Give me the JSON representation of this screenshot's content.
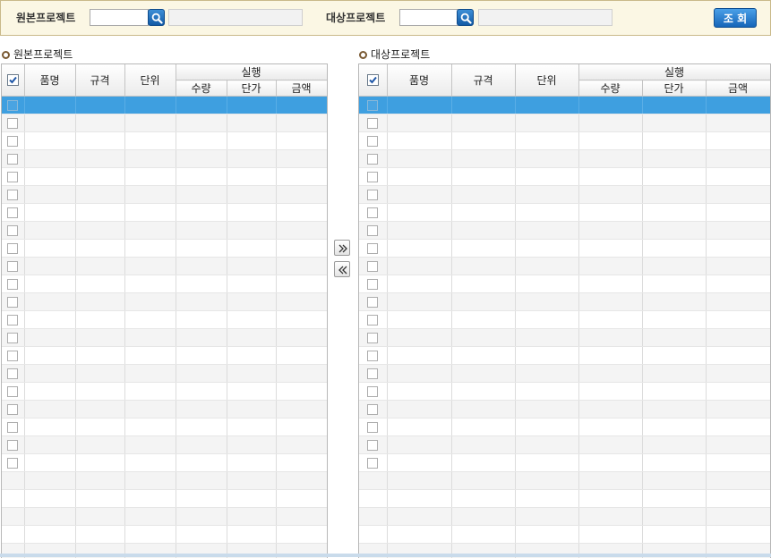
{
  "search": {
    "source_label": "원본프로젝트",
    "source_code": "",
    "source_name": "",
    "target_label": "대상프로젝트",
    "target_code": "",
    "target_name": "",
    "query_label": "조 회"
  },
  "left_panel": {
    "title": "원본프로젝트"
  },
  "right_panel": {
    "title": "대상프로젝트"
  },
  "columns": {
    "item": "품명",
    "spec": "규격",
    "unit": "단위",
    "exec": "실행",
    "qty": "수량",
    "price": "단가",
    "amount": "금액"
  },
  "header_checkbox_checked": true,
  "grid_rows": 26,
  "checkbox_rows": 21,
  "selected_row": 0,
  "colors": {
    "selected_row": "#3e9fe0",
    "search_bg": "#fbf7e4",
    "accent": "#1565b8"
  }
}
